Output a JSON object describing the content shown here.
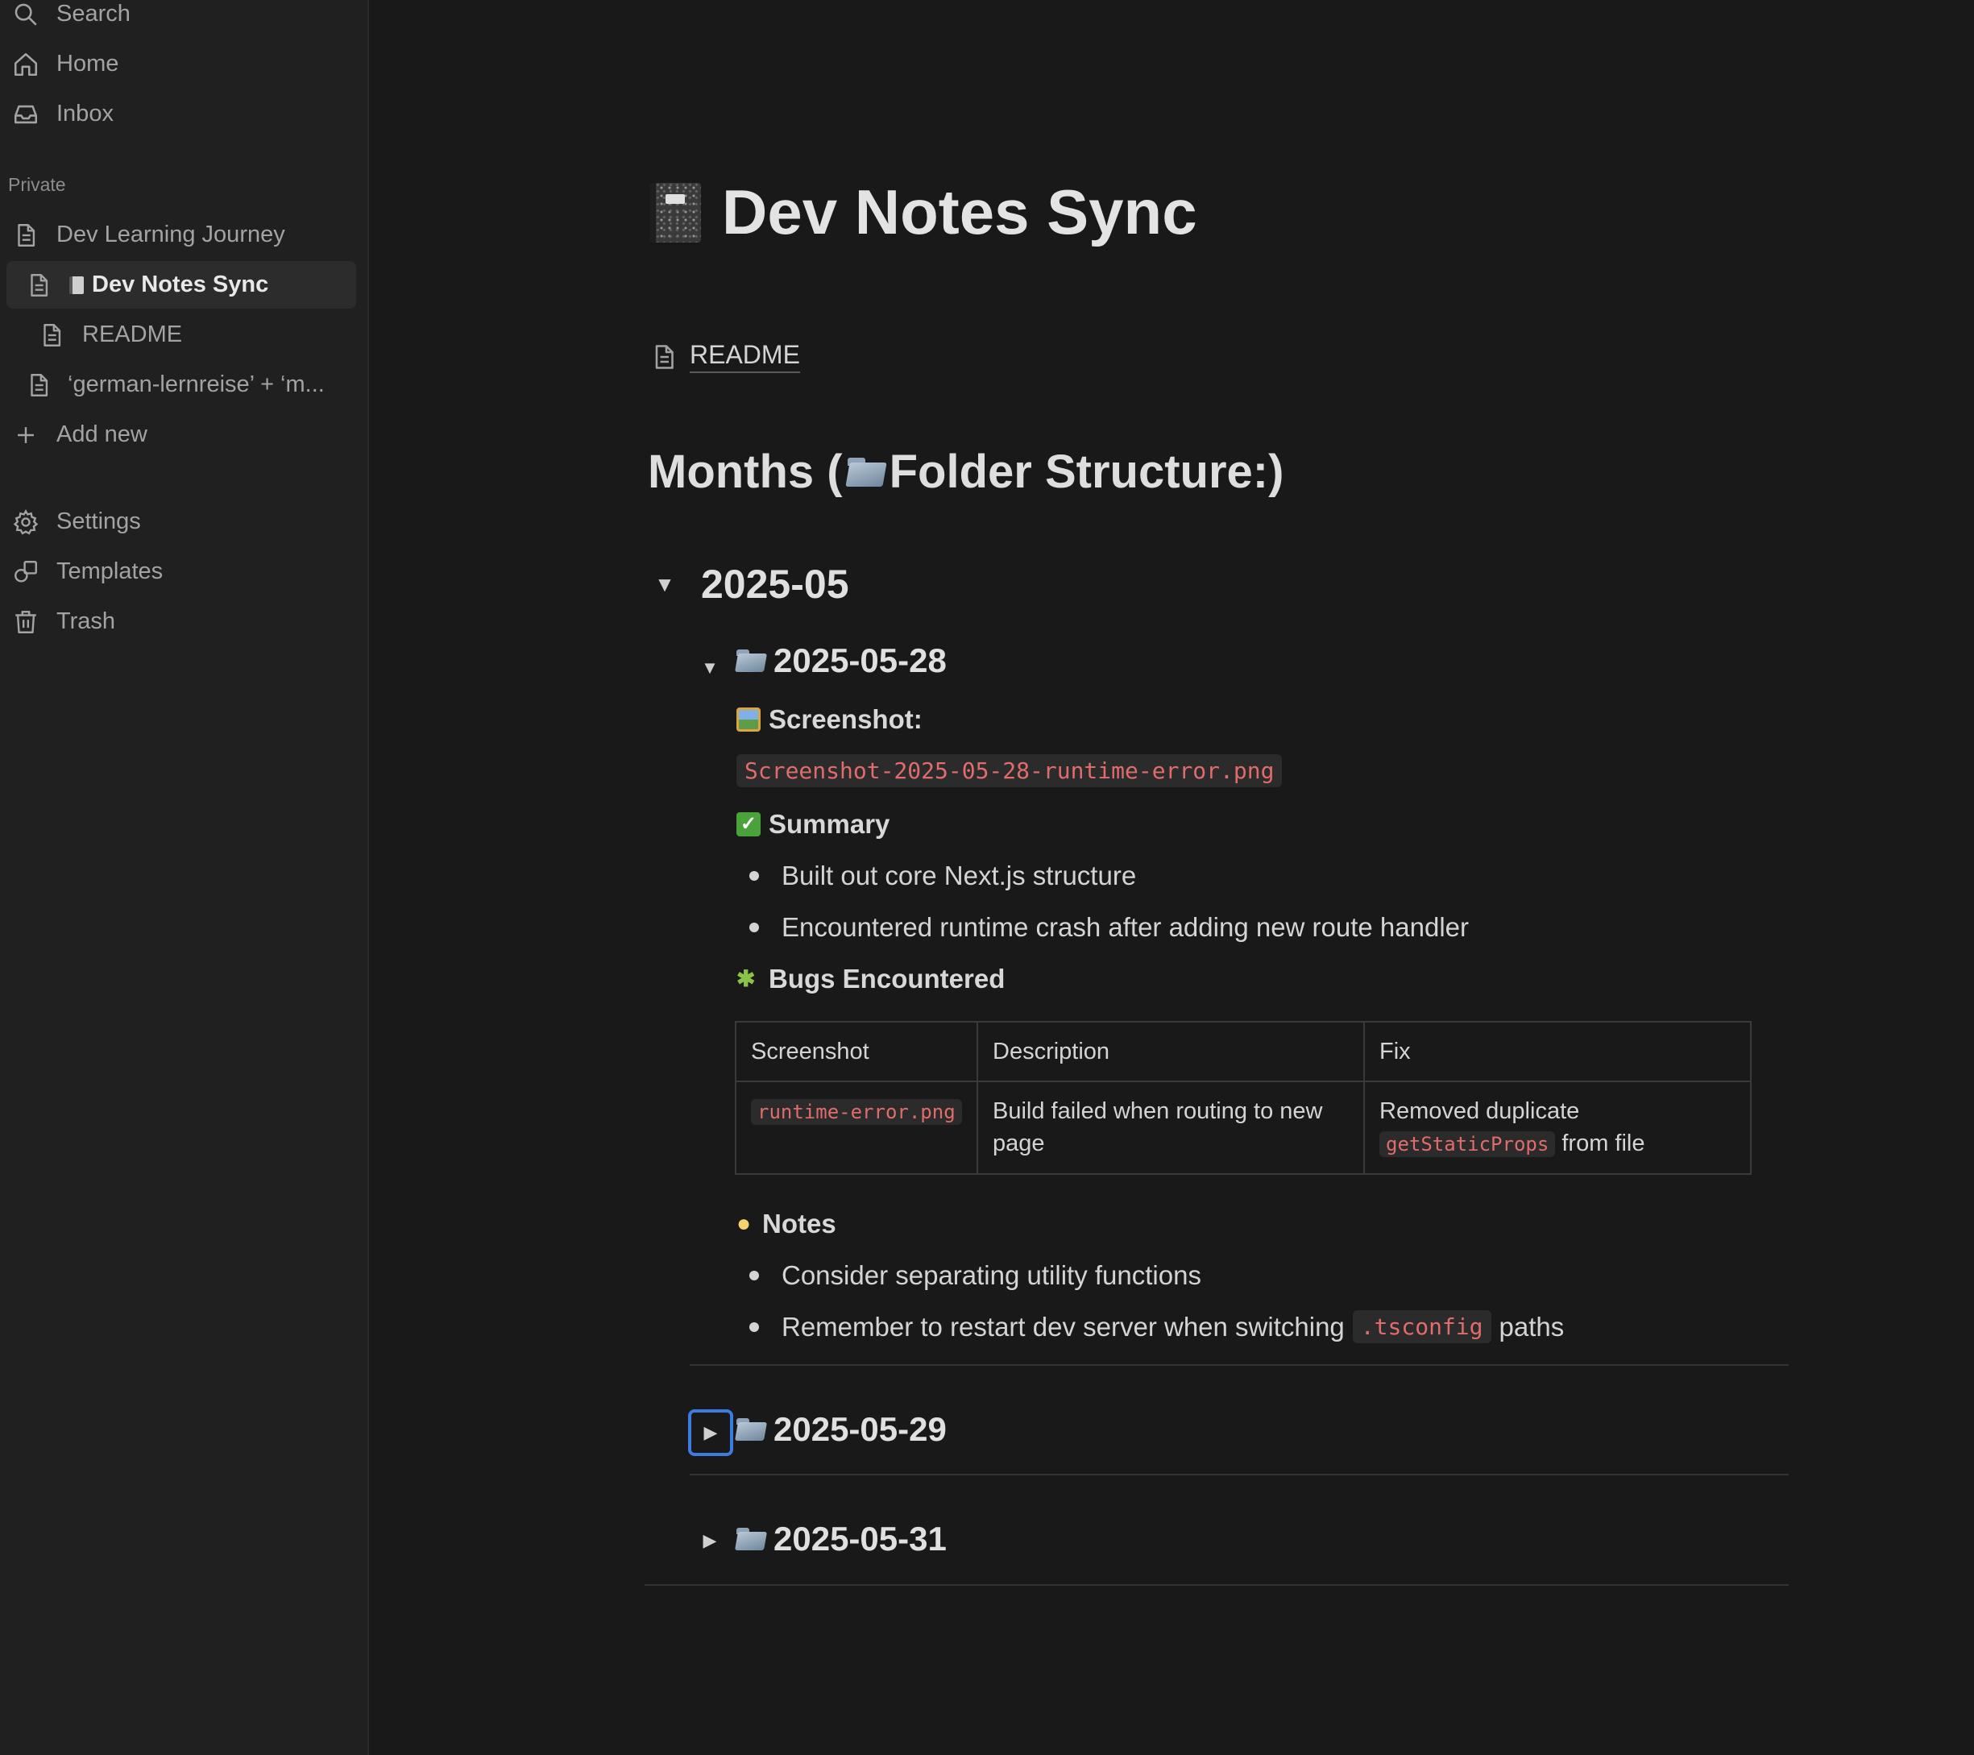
{
  "sidebar": {
    "search": "Search",
    "home": "Home",
    "inbox": "Inbox",
    "section_private": "Private",
    "pages": [
      "Dev Learning Journey",
      "Dev Notes Sync",
      "README",
      "‘german-lernreise’ + ‘m..."
    ],
    "add_new": "Add new",
    "settings": "Settings",
    "templates": "Templates",
    "trash": "Trash"
  },
  "page": {
    "title": "Dev Notes Sync",
    "subpage_link": "README",
    "heading": "Months (",
    "heading_suffix": " Folder Structure:)",
    "month_toggle": "2025-05",
    "day_1": {
      "title": "2025-05-28",
      "screenshot_label": "Screenshot:",
      "screenshot_file": "Screenshot-2025-05-28-runtime-error.png",
      "summary_label": "Summary",
      "summary_items": [
        "Built out core Next.js structure",
        "Encountered runtime crash after adding new route handler"
      ],
      "bugs_label": "Bugs Encountered",
      "table": {
        "headers": [
          "Screenshot",
          "Description",
          "Fix"
        ],
        "row": {
          "screenshot": "runtime-error.png",
          "description": "Build failed when routing to new page",
          "fix_prefix": "Removed duplicate",
          "fix_code": "getStaticProps",
          "fix_suffix": "from file"
        }
      },
      "notes_label": "Notes",
      "notes_items": {
        "first": "Consider separating utility functions",
        "second_prefix": "Remember to restart dev server when switching",
        "second_code": ".tsconfig",
        "second_suffix": "paths"
      }
    },
    "day_2": {
      "title": "2025-05-29"
    },
    "day_3": {
      "title": "2025-05-31"
    }
  },
  "colors": {
    "background": "#191919",
    "sidebar": "#202020",
    "code_text": "#e06c6c",
    "focus_ring": "#3e7be0"
  },
  "icons": [
    "search-icon",
    "home-icon",
    "inbox-icon",
    "document-icon",
    "plus-icon",
    "gear-icon",
    "templates-icon",
    "trash-icon",
    "folder-icon",
    "notebook-icon",
    "image-icon",
    "check-icon",
    "bug-icon",
    "bulb-icon",
    "triangle-down-icon",
    "triangle-right-icon"
  ]
}
